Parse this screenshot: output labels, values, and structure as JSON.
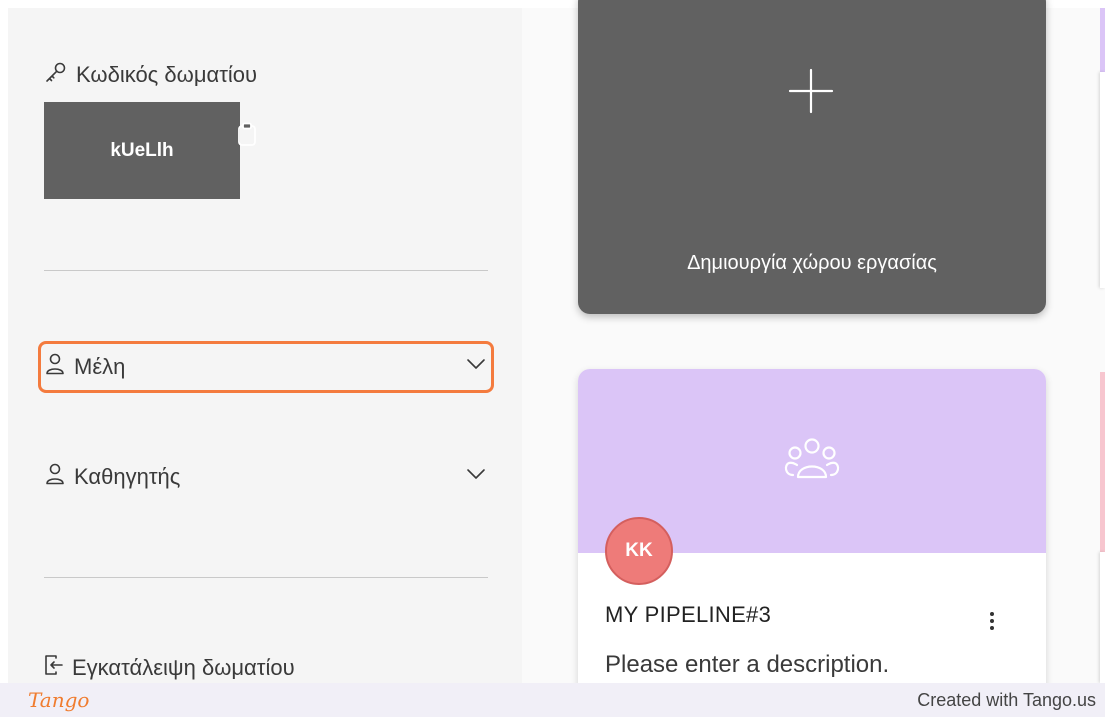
{
  "sidebar": {
    "room_code_label": "Κωδικός δωματίου",
    "room_code": "kUeLlh",
    "members_label": "Μέλη",
    "teacher_label": "Καθηγητής",
    "leave_room_label": "Εγκατάλειψη δωματίου"
  },
  "workspaces": {
    "create_label": "Δημιουργία χώρου εργασίας",
    "cards": [
      {
        "avatar_initials": "KK",
        "title": "MY PIPELINE#3",
        "description": "Please enter a description."
      }
    ]
  },
  "footer": {
    "logo": "Tango",
    "credit": "Created with Tango.us"
  },
  "colors": {
    "highlight": "#f47b3e",
    "create_card": "#616161",
    "banner": "#dbc5f7",
    "avatar": "#ee7b79"
  },
  "icons": [
    "key-icon",
    "clipboard-icon",
    "user-icon",
    "chevron-down-icon",
    "exit-icon",
    "plus-icon",
    "group-icon",
    "kebab-menu-icon"
  ]
}
